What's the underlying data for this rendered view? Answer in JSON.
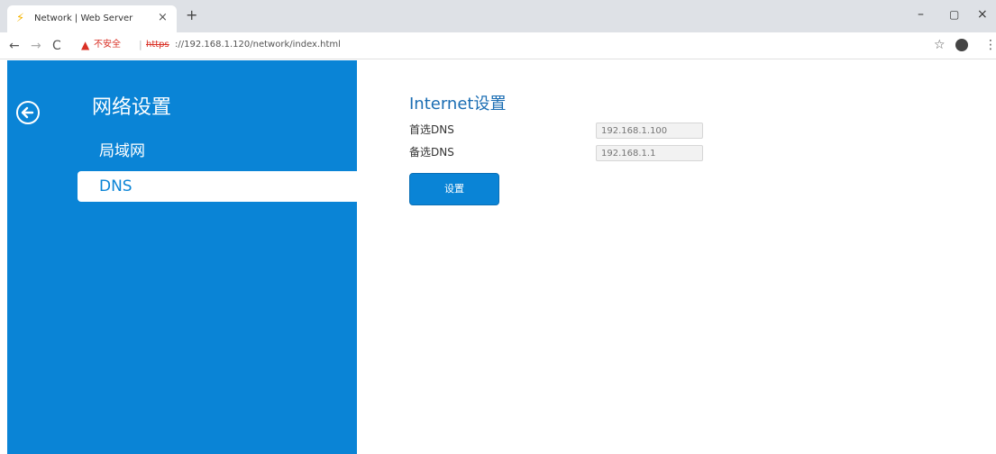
{
  "browser": {
    "tab_title": "Network | Web Server",
    "tab_close": "×",
    "new_tab": "+",
    "security_label": "不安全",
    "url_separator": "|",
    "url_scheme": "https",
    "url_rest": "://192.168.1.120/network/index.html",
    "window_controls": {
      "minimize": "–",
      "maximize": "▢",
      "close": "×"
    },
    "icons": {
      "favicon": "lightning-icon",
      "back": "back-arrow-icon",
      "forward": "forward-arrow-icon",
      "reload": "reload-icon",
      "warning": "warning-icon",
      "star": "star-icon",
      "profile": "profile-icon",
      "menu": "kebab-menu-icon"
    }
  },
  "sidebar": {
    "title": "网络设置",
    "items": [
      {
        "label": "局域网",
        "active": false
      },
      {
        "label": "DNS",
        "active": true
      }
    ],
    "back_icon": "circle-back-arrow-icon"
  },
  "main": {
    "section_title": "Internet设置",
    "fields": [
      {
        "label": "首选DNS",
        "value": "",
        "placeholder": "192.168.1.100"
      },
      {
        "label": "备选DNS",
        "value": "",
        "placeholder": "192.168.1.1"
      }
    ],
    "submit_label": "设置"
  },
  "colors": {
    "sidebar_bg": "#0a84d6",
    "title_blue": "#1a6db3",
    "warning_red": "#d93025"
  }
}
